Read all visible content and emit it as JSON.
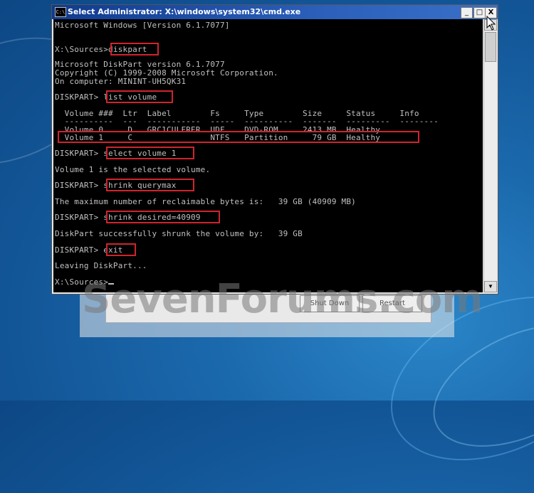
{
  "window": {
    "title": "Select Administrator: X:\\windows\\system32\\cmd.exe",
    "icon_label": "C:\\",
    "controls": {
      "minimize": "_",
      "maximize": "□",
      "close": "X"
    }
  },
  "console": {
    "lines": [
      "Microsoft Windows [Version 6.1.7077]",
      "",
      "X:\\Sources>diskpart",
      "",
      "Microsoft DiskPart version 6.1.7077",
      "Copyright (C) 1999-2008 Microsoft Corporation.",
      "On computer: MININT-UH5QK31",
      "",
      "DISKPART> list volume",
      "",
      "  Volume ###  Ltr  Label        Fs     Type        Size     Status     Info",
      "  ----------  ---  -----------  -----  ----------  -------  ---------  --------",
      "  Volume 0     D   GRC1CULFRER  UDF    DVD-ROM     2413 MB  Healthy",
      "  Volume 1     C                NTFS   Partition     79 GB  Healthy",
      "",
      "DISKPART> select volume 1",
      "",
      "Volume 1 is the selected volume.",
      "",
      "DISKPART> shrink querymax",
      "",
      "The maximum number of reclaimable bytes is:   39 GB (40909 MB)",
      "",
      "DISKPART> shrink desired=40909",
      "",
      "DiskPart successfully shrunk the volume by:   39 GB",
      "",
      "DISKPART> exit",
      "",
      "Leaving DiskPart...",
      "",
      "X:\\Sources>"
    ]
  },
  "setup_dialog": {
    "shutdown_label": "Shut Down",
    "restart_label": "Restart"
  },
  "watermark": "SevenForums.com",
  "colors": {
    "highlight": "#d0242c",
    "console_text": "#c0c0c0",
    "console_bg": "#000000",
    "title_bar": "#2b5fba"
  }
}
